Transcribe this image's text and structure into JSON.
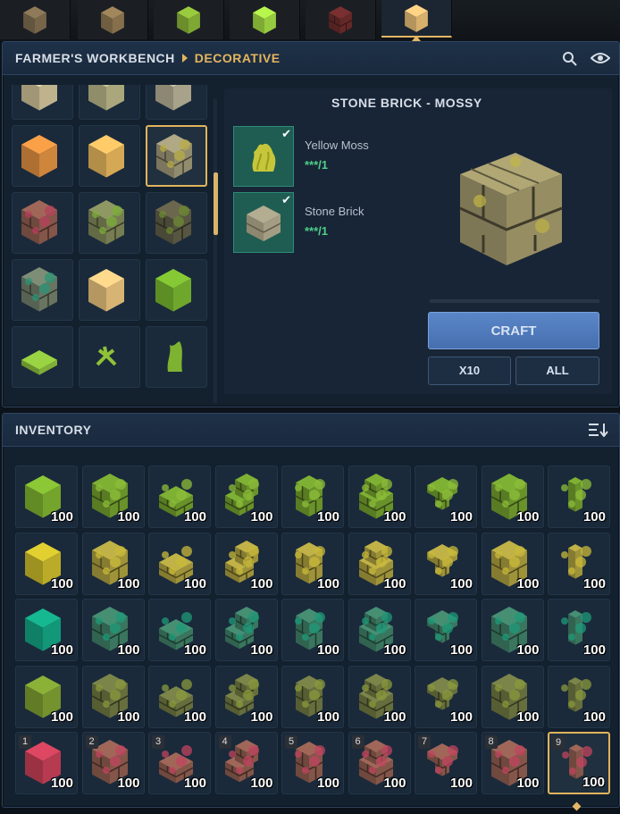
{
  "tabs": [
    {
      "name": "tab-vehicles",
      "icon": "cart-icon"
    },
    {
      "name": "tab-tools",
      "icon": "sack-icon"
    },
    {
      "name": "tab-plants",
      "icon": "sprout-icon"
    },
    {
      "name": "tab-gems",
      "icon": "gem-icon"
    },
    {
      "name": "tab-crates",
      "icon": "crate-icon"
    },
    {
      "name": "tab-decorative",
      "icon": "block-icon",
      "active": true
    }
  ],
  "workbench": {
    "crumb_a": "FARMER'S WORKBENCH",
    "crumb_b": "DECORATIVE",
    "recipe_title": "STONE BRICK - MOSSY",
    "ingredients": [
      {
        "name": "Yellow Moss",
        "count": "***/1",
        "icon": "yellow-moss-icon"
      },
      {
        "name": "Stone Brick",
        "count": "***/1",
        "icon": "stone-brick-icon"
      }
    ],
    "craft_label": "CRAFT",
    "x10_label": "X10",
    "all_label": "ALL"
  },
  "recipe_grid": [
    [
      "sandstone-block",
      "mossy-block",
      "stone-block"
    ],
    [
      "terracotta-block",
      "sand-block",
      "mossy-stone-brick"
    ],
    [
      "red-mossy-brick",
      "green-mossy-brick",
      "dark-mossy-brick"
    ],
    [
      "teal-mossy-brick",
      "sand-block-2",
      "moss-block"
    ],
    [
      "moss-carpet",
      "moss-sprout",
      "moss-vine"
    ],
    [
      "moss-partial",
      "empty",
      "empty"
    ]
  ],
  "inventory": {
    "title": "INVENTORY",
    "hotbar_numbers": [
      "1",
      "2",
      "3",
      "4",
      "5",
      "6",
      "7",
      "8",
      "9"
    ],
    "rows": [
      {
        "tint": "green",
        "qty": [
          "100",
          "100",
          "100",
          "100",
          "100",
          "100",
          "100",
          "100",
          "100"
        ]
      },
      {
        "tint": "yellow",
        "qty": [
          "100",
          "100",
          "100",
          "100",
          "100",
          "100",
          "100",
          "100",
          "100"
        ]
      },
      {
        "tint": "teal",
        "qty": [
          "100",
          "100",
          "100",
          "100",
          "100",
          "100",
          "100",
          "100",
          "100"
        ]
      },
      {
        "tint": "olive",
        "qty": [
          "100",
          "100",
          "100",
          "100",
          "100",
          "100",
          "100",
          "100",
          "100"
        ]
      },
      {
        "tint": "red",
        "qty": [
          "100",
          "100",
          "100",
          "100",
          "100",
          "100",
          "100",
          "100",
          "100"
        ]
      }
    ],
    "shapes": [
      "cube",
      "brick",
      "slab",
      "stairs",
      "wall",
      "stair-brick",
      "pillar",
      "pillar-block",
      "post"
    ]
  },
  "colors": {
    "accent": "#e3b764",
    "craft_button": "#4f79bd",
    "ingredient_bg": "#1f5d52",
    "green_text": "#4ed08a"
  }
}
